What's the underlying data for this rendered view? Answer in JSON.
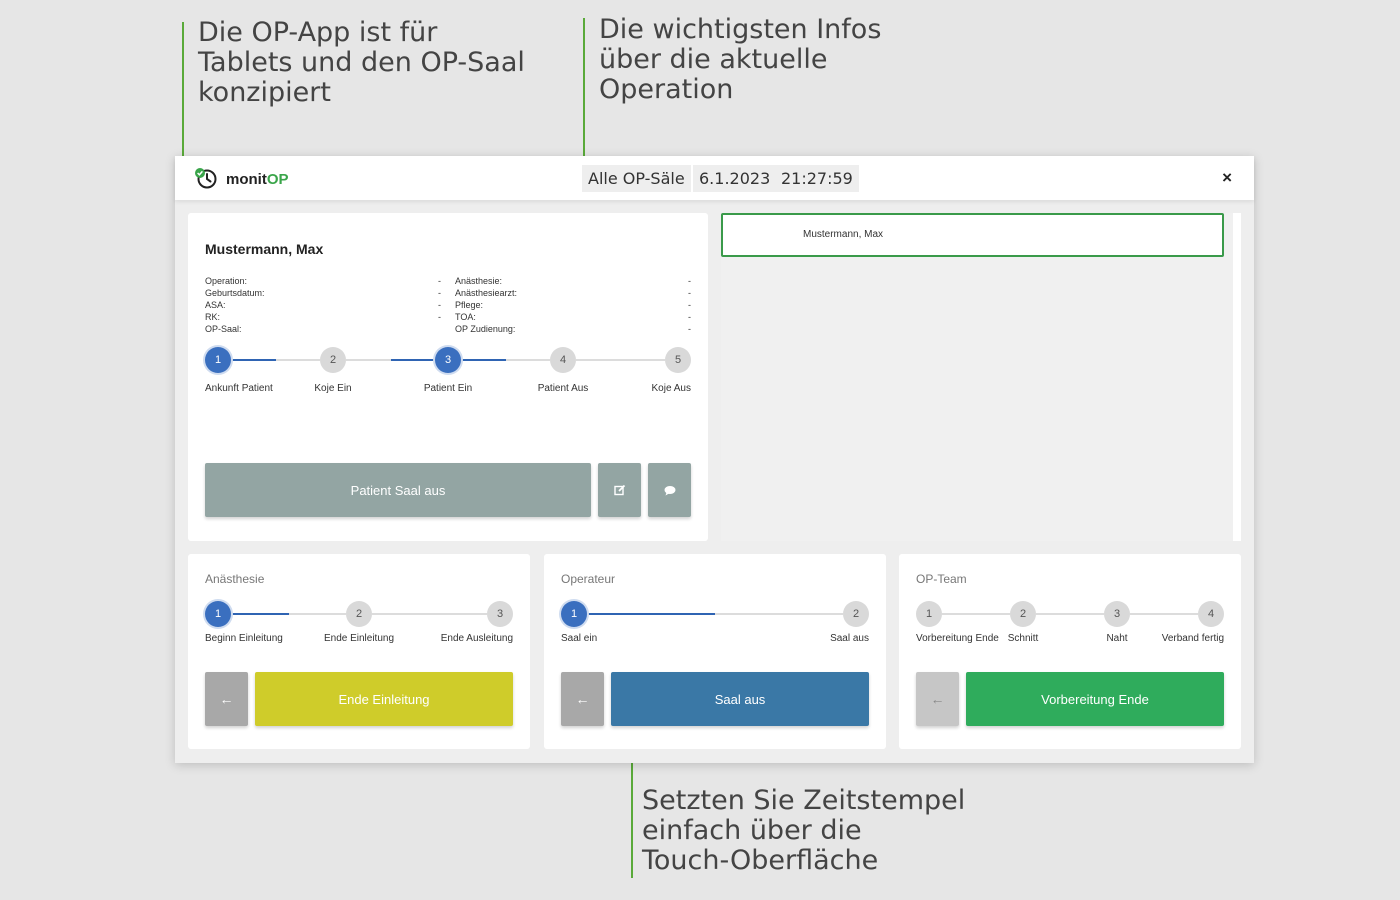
{
  "callouts": {
    "tablet": "Die OP-App ist für\nTablets und den OP-Saal\nkonzipiert",
    "info": "Die wichtigsten Infos\nüber die aktuelle\nOperation",
    "touch": "Setzten Sie Zeitstempel\neinfach über die\nTouch-Oberfläche"
  },
  "header": {
    "logo_main": "monit",
    "logo_accent": "OP",
    "room_filter": "Alle OP-Säle",
    "date": "6.1.2023",
    "time": "21:27:59",
    "close": "×"
  },
  "patient": {
    "name": "Mustermann, Max",
    "left_fields": [
      {
        "label": "Operation:",
        "value": "-"
      },
      {
        "label": "Geburtsdatum:",
        "value": "-"
      },
      {
        "label": "ASA:",
        "value": "-"
      },
      {
        "label": "RK:",
        "value": "-"
      },
      {
        "label": "OP-Saal:",
        "value": ""
      }
    ],
    "right_fields": [
      {
        "label": "Anästhesie:",
        "value": "-"
      },
      {
        "label": "Anästhesiearzt:",
        "value": "-"
      },
      {
        "label": "Pflege:",
        "value": "-"
      },
      {
        "label": "TOA:",
        "value": "-"
      },
      {
        "label": "OP Zudienung:",
        "value": "-"
      }
    ],
    "steps": [
      {
        "num": "1",
        "label": "Ankunft Patient",
        "active": true
      },
      {
        "num": "2",
        "label": "Koje Ein",
        "active": false
      },
      {
        "num": "3",
        "label": "Patient Ein",
        "active": true
      },
      {
        "num": "4",
        "label": "Patient Aus",
        "active": false
      },
      {
        "num": "5",
        "label": "Koje Aus",
        "active": false
      }
    ],
    "action_label": "Patient Saal aus",
    "edit_icon": "edit-icon",
    "comment_icon": "comment-icon"
  },
  "patient_list": [
    "Mustermann, Max"
  ],
  "anaesthesie": {
    "title": "Anästhesie",
    "steps": [
      {
        "num": "1",
        "label": "Beginn Einleitung",
        "active": true
      },
      {
        "num": "2",
        "label": "Ende Einleitung",
        "active": false
      },
      {
        "num": "3",
        "label": "Ende Ausleitung",
        "active": false
      }
    ],
    "action_label": "Ende Einleitung",
    "action_color": "#cfcc2a"
  },
  "operateur": {
    "title": "Operateur",
    "steps": [
      {
        "num": "1",
        "label": "Saal ein",
        "active": true
      },
      {
        "num": "2",
        "label": "Saal aus",
        "active": false
      }
    ],
    "action_label": "Saal aus",
    "action_color": "#3a78a6"
  },
  "opteam": {
    "title": "OP-Team",
    "steps": [
      {
        "num": "1",
        "label": "Vorbereitung Ende",
        "active": false
      },
      {
        "num": "2",
        "label": "Schnitt",
        "active": false
      },
      {
        "num": "3",
        "label": "Naht",
        "active": false
      },
      {
        "num": "4",
        "label": "Verband fertig",
        "active": false
      }
    ],
    "action_label": "Vorbereitung Ende",
    "action_color": "#2fac5c"
  },
  "back_arrow": "←",
  "colors": {
    "accent_green": "#3aa54a",
    "step_active": "#3a6fbf"
  }
}
